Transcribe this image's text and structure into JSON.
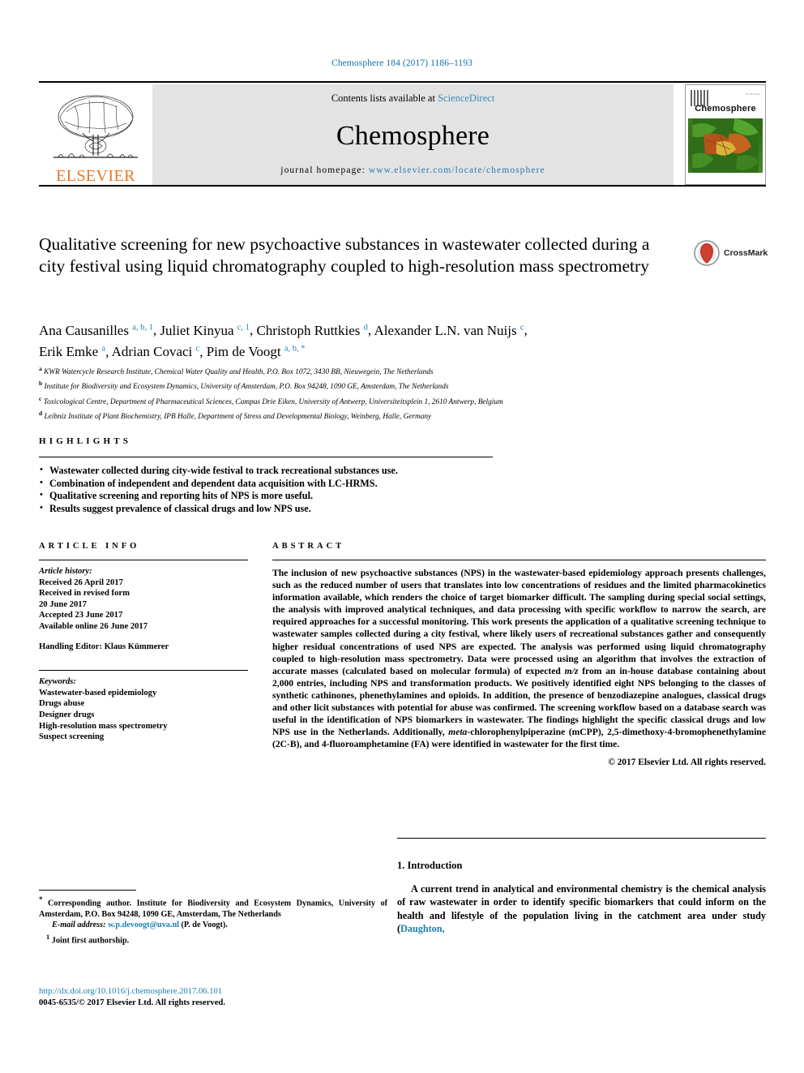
{
  "running_head": "Chemosphere 184 (2017) 1186–1193",
  "masthead": {
    "contents_prefix": "Contents lists available at ",
    "contents_link": "ScienceDirect",
    "journal_name": "Chemosphere",
    "homepage_label": "journal homepage: ",
    "homepage_url": "www.elsevier.com/locate/chemosphere",
    "publisher": "ELSEVIER",
    "cover_title": "Chemosphere",
    "cover_corner_text": "ELSEVIER"
  },
  "crossmark": {
    "label": "CrossMark"
  },
  "article": {
    "title": "Qualitative screening for new psychoactive substances in wastewater collected during a city festival using liquid chromatography coupled to high-resolution mass spectrometry",
    "authors_line1": "Ana Causanilles",
    "authors_line1_sup": "a, b, 1",
    "authors": [
      {
        "name": "Ana Causanilles",
        "sup": "a, b, 1"
      },
      {
        "name": "Juliet Kinyua",
        "sup": "c, 1"
      },
      {
        "name": "Christoph Ruttkies",
        "sup": "d"
      },
      {
        "name": "Alexander L.N. van Nuijs",
        "sup": "c"
      },
      {
        "name": "Erik Emke",
        "sup": "a"
      },
      {
        "name": "Adrian Covaci",
        "sup": "c"
      },
      {
        "name": "Pim de Voogt",
        "sup": "a, b, *"
      }
    ],
    "affiliations": [
      {
        "marker": "a",
        "text": "KWR Watercycle Research Institute, Chemical Water Quality and Health, P.O. Box 1072, 3430 BB, Nieuwegein, The Netherlands"
      },
      {
        "marker": "b",
        "text": "Institute for Biodiversity and Ecosystem Dynamics, University of Amsterdam, P.O. Box 94248, 1090 GE, Amsterdam, The Netherlands"
      },
      {
        "marker": "c",
        "text": "Toxicological Centre, Department of Pharmaceutical Sciences, Campus Drie Eiken, University of Antwerp, Universiteitsplein 1, 2610 Antwerp, Belgium"
      },
      {
        "marker": "d",
        "text": "Leibniz Institute of Plant Biochemistry, IPB Halle, Department of Stress and Developmental Biology, Weinberg, Halle, Germany"
      }
    ]
  },
  "highlights": {
    "heading": "HIGHLIGHTS",
    "items": [
      "Wastewater collected during city-wide festival to track recreational substances use.",
      "Combination of independent and dependent data acquisition with LC-HRMS.",
      "Qualitative screening and reporting hits of NPS is more useful.",
      "Results suggest prevalence of classical drugs and low NPS use."
    ]
  },
  "article_info": {
    "heading": "ARTICLE INFO",
    "history_label": "Article history:",
    "history": [
      "Received 26 April 2017",
      "Received in revised form",
      "20 June 2017",
      "Accepted 23 June 2017",
      "Available online 26 June 2017"
    ],
    "handling_editor": "Handling Editor: Klaus Kümmerer",
    "keywords_label": "Keywords:",
    "keywords": [
      "Wastewater-based epidemiology",
      "Drugs abuse",
      "Designer drugs",
      "High-resolution mass spectrometry",
      "Suspect screening"
    ]
  },
  "abstract": {
    "heading": "ABSTRACT",
    "part1": "The inclusion of new psychoactive substances (NPS) in the wastewater-based epidemiology approach presents challenges, such as the reduced number of users that translates into low concentrations of residues and the limited pharmacokinetics information available, which renders the choice of target biomarker difficult. The sampling during special social settings, the analysis with improved analytical techniques, and data processing with specific workflow to narrow the search, are required approaches for a successful monitoring. This work presents the application of a qualitative screening technique to wastewater samples collected during a city festival, where likely users of recreational substances gather and consequently higher residual concentrations of used NPS are expected. The analysis was performed using liquid chromatography coupled to high-resolution mass spectrometry. Data were processed using an algorithm that involves the extraction of accurate masses (calculated based on molecular formula) of expected ",
    "italic1": "m/z",
    "part2": " from an in-house database containing about 2,000 entries, including NPS and transformation products. We positively identified eight NPS belonging to the classes of synthetic cathinones, phenethylamines and opioids. In addition, the presence of benzodiazepine analogues, classical drugs and other licit substances with potential for abuse was confirmed. The screening workflow based on a database search was useful in the identification of NPS biomarkers in wastewater. The findings highlight the specific classical drugs and low NPS use in the Netherlands. Additionally, ",
    "italic2": "meta",
    "part3": "-chlorophenylpiperazine (mCPP), 2,5-dimethoxy-4-bromophenethylamine (2C-B), and 4-fluoroamphetamine (FA) were identified in wastewater for the first time.",
    "copyright": "© 2017 Elsevier Ltd. All rights reserved."
  },
  "introduction": {
    "heading": "1. Introduction",
    "paragraph_start": "A current trend in analytical and environmental chemistry is the chemical analysis of raw wastewater in order to identify specific biomarkers that could inform on the health and lifestyle of the population living in the catchment area under study (",
    "citation": "Daughton,"
  },
  "footnotes": {
    "corresponding_marker": "*",
    "corresponding": " Corresponding author. Institute for Biodiversity and Ecosystem Dynamics, University of Amsterdam, P.O. Box 94248, 1090 GE, Amsterdam, The Netherlands",
    "email_label": "E-mail address:",
    "email": "w.p.devoogt@uva.nl",
    "email_suffix": "(P. de Voogt).",
    "joint_marker": "1",
    "joint": "Joint first authorship."
  },
  "footer": {
    "doi": "http://dx.doi.org/10.1016/j.chemosphere.2017.06.101",
    "issn": "0045-6535/© 2017 Elsevier Ltd. All rights reserved."
  },
  "colors": {
    "link_blue": "#1b7fb5",
    "elsevier_orange": "#E87722",
    "masthead_gray": "#e3e3e3"
  }
}
